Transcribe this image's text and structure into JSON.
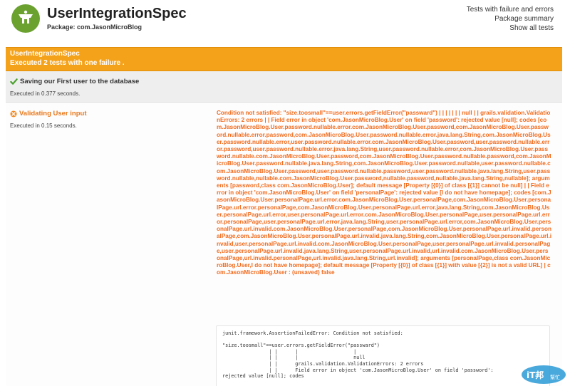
{
  "header": {
    "title": "UserIntegrationSpec",
    "package": "Package: com.JasonMicroBlog",
    "links": [
      "Tests with failure and errors",
      "Package summary",
      "Show all tests"
    ],
    "logo_icon": "spock-logo-icon"
  },
  "summary": {
    "title": "UserIntegrationSpec",
    "subtitle": "Executed 2 tests with one failure .",
    "color": "#f5a21b"
  },
  "tests": [
    {
      "name": "Saving our First user to the database",
      "time": "Executed in 0.377 seconds.",
      "status": "passed",
      "icon": "check-icon"
    },
    {
      "name": "Validating User input",
      "time": "Executed in 0.15 seconds.",
      "status": "failed",
      "icon": "error-icon",
      "failure_message": "Condition not satisfied: \"size.toosmall\"==user.errors.getFieldError(\"passward\") | | | | | | | null | | grails.validation.ValidationErrors: 2 errors | | Field error in object 'com.JasonMicroBlog.User' on field 'password': rejected value [null]; codes [com.JasonMicroBlog.User.password.nullable.error.com.JasonMicroBlog.User.password,com.JasonMicroBlog.User.password.nullable.error.password,com.JasonMicroBlog.User.password.nullable.error.java.lang.String,com.JasonMicroBlog.User.password.nullable.error,user.password.nullable.error.com.JasonMicroBlog.User.password,user.password.nullable.error.password,user.password.nullable.error.java.lang.String,user.password.nullable.error,com.JasonMicroBlog.User.password.nullable.com.JasonMicroBlog.User.password,com.JasonMicroBlog.User.password.nullable.password,com.JasonMicroBlog.User.password.nullable.java.lang.String,com.JasonMicroBlog.User.password.nullable,user.password.nullable.com.JasonMicroBlog.User.password,user.password.nullable.password,user.password.nullable.java.lang.String,user.password.nullable,nullable.com.JasonMicroBlog.User.password,nullable.password,nullable.java.lang.String,nullable]; arguments [password,class com.JasonMicroBlog.User]; default message [Property [{0}] of class [{1}] cannot be null] | | Field error in object 'com.JasonMicroBlog.User' on field 'personalPage': rejected value [I do not have homepage]; codes [com.JasonMicroBlog.User.personalPage.url.error.com.JasonMicroBlog.User.personalPage,com.JasonMicroBlog.User.personalPage.url.error.personalPage,com.JasonMicroBlog.User.personalPage.url.error.java.lang.String,com.JasonMicroBlog.User.personalPage.url.error,user.personalPage.url.error.com.JasonMicroBlog.User.personalPage,user.personalPage.url.error.personalPage,user.personalPage.url.error.java.lang.String,user.personalPage.url.error,com.JasonMicroBlog.User.personalPage.url.invalid.com.JasonMicroBlog.User.personalPage,com.JasonMicroBlog.User.personalPage.url.invalid.personalPage,com.JasonMicroBlog.User.personalPage.url.invalid.java.lang.String,com.JasonMicroBlog.User.personalPage.url.invalid,user.personalPage.url.invalid.com.JasonMicroBlog.User.personalPage,user.personalPage.url.invalid.personalPage,user.personalPage.url.invalid.java.lang.String,user.personalPage.url.invalid,url.invalid.com.JasonMicroBlog.User.personalPage,url.invalid.personalPage,url.invalid.java.lang.String,url.invalid]; arguments [personalPage,class com.JasonMicroBlog.User,I do not have homepage]; default message [Property [{0}] of class [{1}] with value [{2}] is not a valid URL] | com.JasonMicroBlog.User : (unsaved) false",
      "stack_trace": "junit.framework.AssertionFailedError: Condition not satisfied:\n\n\"size.toosmall\"==user.errors.getFieldError(\"passward\")\n                | |      |                   |\n                | |      |                   null\n                | |      grails.validation.ValidationErrors: 2 errors\n                | |      Field error in object 'com.JasonMicroBlog.User' on field 'password':\nrejected value [null]; codes"
    }
  ],
  "watermark": {
    "text": "iT邦",
    "subtext": "幫忙",
    "color": "#2a9ad6"
  }
}
